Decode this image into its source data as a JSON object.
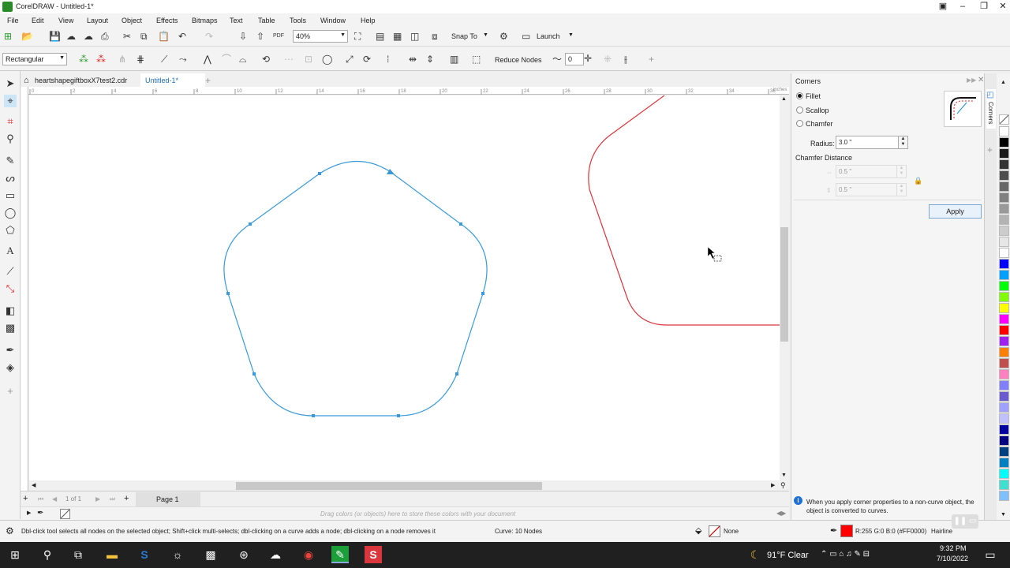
{
  "titlebar": {
    "title": "CorelDRAW - Untitled-1*"
  },
  "menu": [
    "File",
    "Edit",
    "View",
    "Layout",
    "Object",
    "Effects",
    "Bitmaps",
    "Text",
    "Table",
    "Tools",
    "Window",
    "Help"
  ],
  "toolbar1": {
    "zoom": "40%",
    "snap_to": "Snap To",
    "launch": "Launch"
  },
  "toolbar2": {
    "shape_mode": "Rectangular",
    "reduce_nodes": "Reduce Nodes",
    "smoothness": "0"
  },
  "doc_tabs": [
    {
      "label": "heartshapegiftboxX7test2.cdr"
    },
    {
      "label": "Untitled-1*"
    }
  ],
  "ruler_h_ticks": [
    "0",
    "2",
    "4",
    "6",
    "8",
    "10",
    "12",
    "14",
    "16",
    "18",
    "20",
    "22",
    "24",
    "26",
    "28",
    "30",
    "32",
    "34",
    "36"
  ],
  "ruler_unit": "inches",
  "pagebar": {
    "page_info": "1 of 1",
    "page_tab": "Page 1"
  },
  "palette_hint": "Drag colors (or objects) here to store these colors with your document",
  "docker": {
    "title": "Corners",
    "options": [
      "Fillet",
      "Scallop",
      "Chamfer"
    ],
    "selected": "Fillet",
    "radius_label": "Radius:",
    "radius_value": "3.0 \"",
    "chamfer_label": "Chamfer Distance",
    "chamfer_v1": "0.5 \"",
    "chamfer_v2": "0.5 \"",
    "apply": "Apply",
    "info": "When you apply corner properties to a non-curve object, the object is converted to curves.",
    "side_tab": "Corners"
  },
  "statusbar": {
    "hint": "Dbl-click tool selects all nodes on the selected object; Shift+click multi-selects; dbl-clicking on a curve adds a node; dbl-clicking on a node removes it",
    "curve_info": "Curve: 10 Nodes",
    "fill": "None",
    "outline_color": "R:255 G:0 B:0 (#FF0000)",
    "outline_width": "Hairline"
  },
  "taskbar": {
    "weather": "91°F  Clear",
    "time": "9:32 PM",
    "date": "7/10/2022"
  },
  "colors": {
    "accent": "#1e90d6",
    "shape_blue": "#3a9ad9",
    "shape_red": "#d9363e",
    "panel": "#f5f5f5"
  },
  "palette_colors": [
    "#ffffff",
    "#000000",
    "#1a1a1a",
    "#333333",
    "#4d4d4d",
    "#666666",
    "#808080",
    "#999999",
    "#b3b3b3",
    "#cccccc",
    "#e6e6e6",
    "#ffffff",
    "#0000ff",
    "#00a0ff",
    "#00ff00",
    "#80ff00",
    "#ffff00",
    "#ff00ff",
    "#ff0000",
    "#a020f0",
    "#ff8000",
    "#c0504d",
    "#ff80c0",
    "#8080ff",
    "#6a5acd",
    "#a0a0ff",
    "#c0c0ff",
    "#0000a0",
    "#000080",
    "#004080",
    "#0080c0",
    "#00ffff",
    "#40e0d0",
    "#80c0ff"
  ]
}
